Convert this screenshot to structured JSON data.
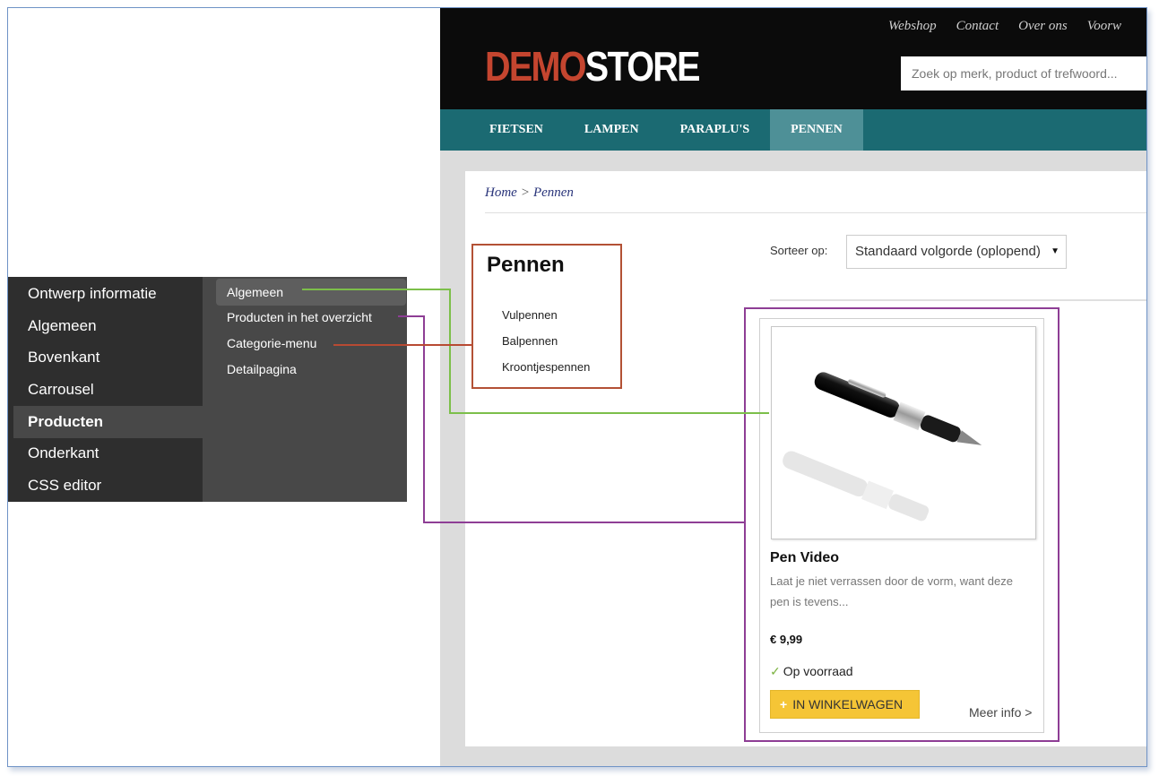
{
  "shop": {
    "top_links": [
      "Webshop",
      "Contact",
      "Over ons",
      "Voorw"
    ],
    "logo": {
      "part1": "DEMO",
      "part2": "STORE"
    },
    "search_placeholder": "Zoek op merk, product of trefwoord...",
    "nav": [
      {
        "label": "FIETSEN"
      },
      {
        "label": "LAMPEN"
      },
      {
        "label": "PARAPLU'S"
      },
      {
        "label": "PENNEN",
        "active": true
      }
    ],
    "breadcrumb": {
      "home": "Home",
      "separator": ">",
      "current": "Pennen"
    },
    "category": {
      "title": "Pennen",
      "items": [
        "Vulpennen",
        "Balpennen",
        "Kroontjespennen"
      ]
    },
    "sort": {
      "label": "Sorteer op:",
      "selected": "Standaard volgorde (oplopend)"
    },
    "product": {
      "title": "Pen Video",
      "description": "Laat je niet verrassen door de vorm, want deze pen is tevens...",
      "price": "€ 9,99",
      "stock": "Op voorraad",
      "cart_button": "IN WINKELWAGEN",
      "more_info": "Meer info >"
    }
  },
  "cms": {
    "menu": [
      {
        "label": "Ontwerp informatie"
      },
      {
        "label": "Algemeen"
      },
      {
        "label": "Bovenkant"
      },
      {
        "label": "Carrousel"
      },
      {
        "label": "Producten",
        "active": true
      },
      {
        "label": "Onderkant"
      },
      {
        "label": "CSS editor"
      }
    ],
    "submenu": [
      {
        "label": "Algemeen",
        "active": true
      },
      {
        "label": "Producten in het overzicht"
      },
      {
        "label": "Categorie-menu"
      },
      {
        "label": "Detailpagina"
      }
    ]
  },
  "colors": {
    "logo_accent": "#c4452f",
    "nav_bg": "#1b6a72",
    "nav_active": "#4e9097",
    "connector_green": "#7cbf4a",
    "connector_red": "#b84a33",
    "connector_purple": "#8e3e95",
    "cart_button": "#f5c536"
  }
}
